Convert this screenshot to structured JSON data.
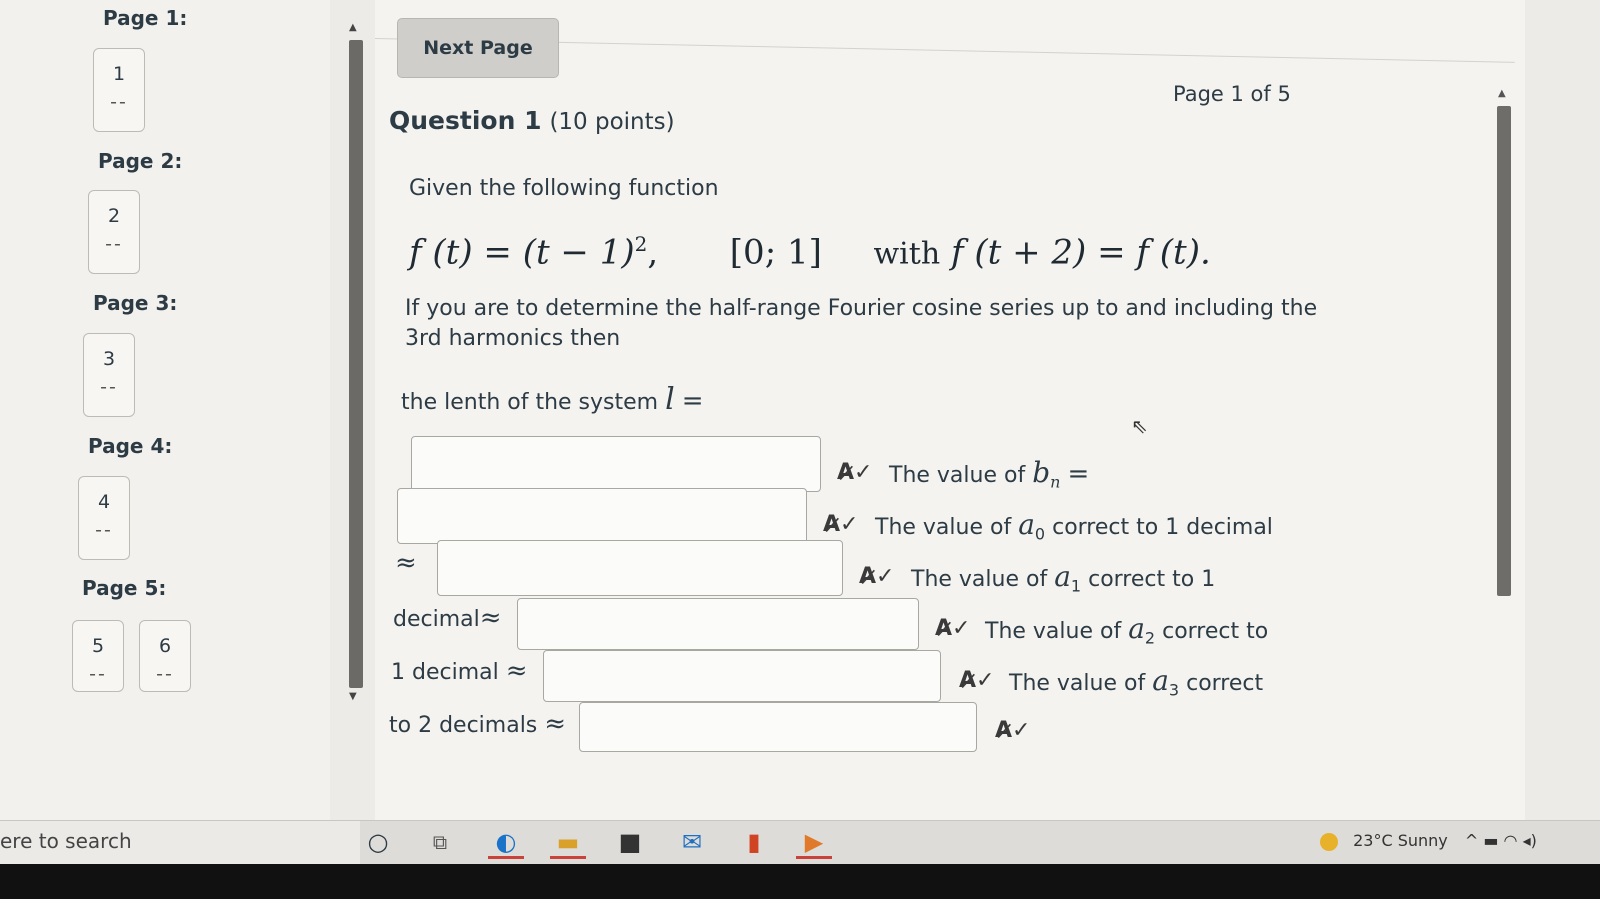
{
  "nav": {
    "page1_label": "Page 1:",
    "page2_label": "Page 2:",
    "page3_label": "Page 3:",
    "page4_label": "Page 4:",
    "page5_label": "Page 5:",
    "boxes": [
      {
        "num": "1",
        "dash": "--"
      },
      {
        "num": "2",
        "dash": "--"
      },
      {
        "num": "3",
        "dash": "--"
      },
      {
        "num": "4",
        "dash": "--"
      },
      {
        "num": "5",
        "dash": "--"
      },
      {
        "num": "6",
        "dash": "--"
      }
    ]
  },
  "content": {
    "next_button": "Next Page",
    "page_indicator": "Page 1 of 5",
    "question_title": "Question 1",
    "question_points": "(10 points)",
    "intro": "Given the following function",
    "formula": {
      "lhs": "f (t) = (t − 1)",
      "exp": "2",
      "comma": ",",
      "interval": "[0;  1]",
      "with": "with",
      "rhs": "f (t + 2) = f (t)."
    },
    "instruction_line1": "If you are to determine the half-range Fourier cosine series up to and including the",
    "instruction_line2": "3rd harmonics then",
    "length_label": "the lenth of the system",
    "length_var": "l",
    "equals": "=",
    "labels": {
      "bn_prefix": "The value of",
      "bn_var": "b",
      "bn_sub": "n",
      "bn_suffix": "=",
      "a0_prefix": "The value of",
      "a0_var": "a",
      "a0_sub": "0",
      "a0_suffix": "correct to 1 decimal",
      "a1_prefix": "The value of",
      "a1_var": "a",
      "a1_sub": "1",
      "a1_suffix": "correct to 1",
      "a2_prefix": "The value of",
      "a2_var": "a",
      "a2_sub": "2",
      "a2_suffix": "correct to",
      "a3_prefix": "The value of",
      "a3_var": "a",
      "a3_sub": "3",
      "a3_suffix": "correct"
    },
    "approx": "≈",
    "decimal_word": "decimal",
    "one_decimal": "1 decimal",
    "two_decimals": "to 2 decimals",
    "spell_icon": "A̷✓"
  },
  "taskbar": {
    "search_text": "ere to search",
    "weather": "23°C  Sunny",
    "tray_icons": "^ ▬ ◠ ◂)"
  }
}
